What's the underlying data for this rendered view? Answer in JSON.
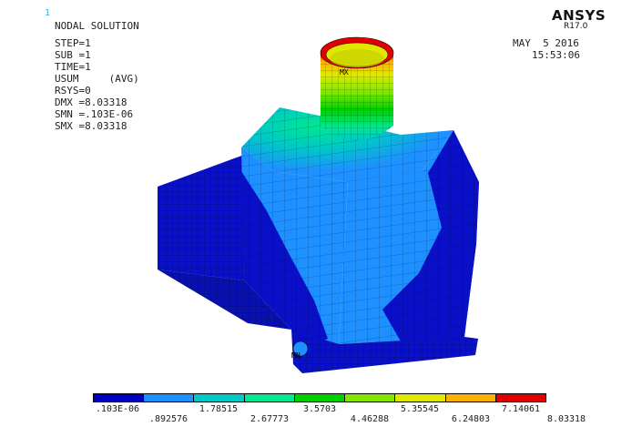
{
  "window_number": "1",
  "title": "NODAL SOLUTION",
  "params": [
    "STEP=1",
    "SUB =1",
    "TIME=1",
    "USUM     (AVG)",
    "RSYS=0",
    "DMX =8.03318",
    "SMN =.103E-06",
    "SMX =8.03318"
  ],
  "brand": {
    "name": "ANSYS",
    "version": "R17.0"
  },
  "date": "MAY  5 2016",
  "time": "15:53:06",
  "model_markers": [
    "MX",
    "MN"
  ],
  "legend": {
    "colors": [
      "#0000c0",
      "#1e90ff",
      "#00c8c8",
      "#00e890",
      "#00d000",
      "#80e800",
      "#e0e800",
      "#ffb000",
      "#e00000"
    ],
    "top_labels": [
      ".103E-06",
      "1.78515",
      "3.5703",
      "5.35545",
      "7.14061"
    ],
    "bottom_labels": [
      ".892576",
      "2.67773",
      "4.46288",
      "6.24803",
      "8.03318"
    ]
  }
}
